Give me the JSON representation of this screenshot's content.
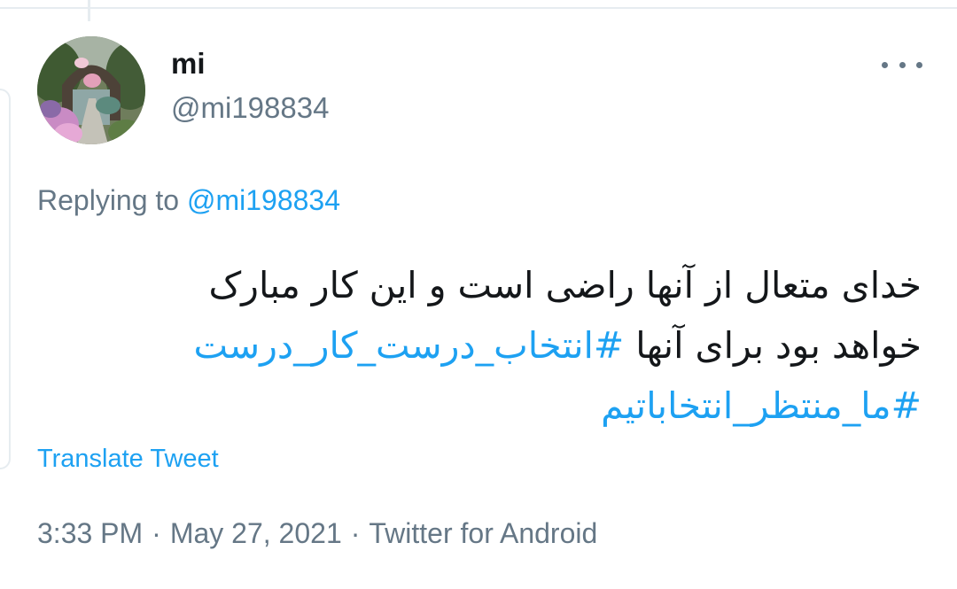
{
  "author": {
    "display_name": "mi",
    "handle": "@mi198834",
    "avatar_icon": "garden-arch-photo"
  },
  "more_icon": "more-horizontal-icon",
  "reply": {
    "prefix": "Replying to",
    "mention": "@mi198834"
  },
  "tweet": {
    "line1": "خدای متعال از آنها راضی است و این کار مبارک",
    "line2_text": "خواهد بود برای آنها ",
    "hashtag1": "#انتخاب_درست_کار_درست",
    "hashtag2": "#ما_منتظر_انتخاباتیم"
  },
  "translate_label": "Translate Tweet",
  "meta": {
    "time": "3:33 PM",
    "separator": "·",
    "date": "May 27, 2021",
    "source": "Twitter for Android"
  },
  "colors": {
    "link": "#1da1f2",
    "secondary_text": "#657786",
    "primary_text": "#14171a",
    "border": "#e6ecf0"
  }
}
